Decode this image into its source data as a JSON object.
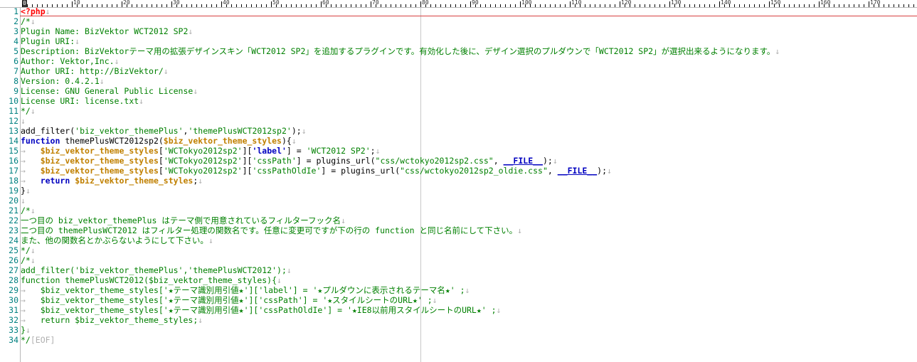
{
  "ruler": {
    "cursor_col": "0",
    "labels": [
      "10",
      "20",
      "30",
      "40",
      "50",
      "60",
      "70",
      "80",
      "90",
      "100",
      "110",
      "120",
      "130",
      "140",
      "150",
      "160",
      "170"
    ]
  },
  "eol_mark": "↓",
  "tab_mark": "→",
  "lines": [
    {
      "n": "1",
      "segments": [
        {
          "t": "php",
          "v": "<?php"
        },
        {
          "t": "mark",
          "v": "↓"
        }
      ]
    },
    {
      "n": "2",
      "segments": [
        {
          "t": "cm",
          "v": "/*"
        },
        {
          "t": "mark",
          "v": "↓"
        }
      ]
    },
    {
      "n": "3",
      "segments": [
        {
          "t": "cm",
          "v": "Plugin Name: BizVektor WCT2012 SP2"
        },
        {
          "t": "mark",
          "v": "↓"
        }
      ]
    },
    {
      "n": "4",
      "segments": [
        {
          "t": "cm",
          "v": "Plugin URI:"
        },
        {
          "t": "mark",
          "v": "↓"
        }
      ]
    },
    {
      "n": "5",
      "segments": [
        {
          "t": "cm",
          "v": "Description: BizVektorテーマ用の拡張デザインスキン「WCT2012 SP2」を追加するプラグインです。有効化した後に、デザイン選択のプルダウンで「WCT2012 SP2」が選択出来るようになります。"
        },
        {
          "t": "mark",
          "v": "↓"
        }
      ]
    },
    {
      "n": "6",
      "segments": [
        {
          "t": "cm",
          "v": "Author: Vektor,Inc."
        },
        {
          "t": "mark",
          "v": "↓"
        }
      ]
    },
    {
      "n": "7",
      "segments": [
        {
          "t": "cm",
          "v": "Author URI: http://BizVektor/"
        },
        {
          "t": "mark",
          "v": "↓"
        }
      ]
    },
    {
      "n": "8",
      "segments": [
        {
          "t": "cm",
          "v": "Version: 0.4.2.1"
        },
        {
          "t": "mark",
          "v": "↓"
        }
      ]
    },
    {
      "n": "9",
      "segments": [
        {
          "t": "cm",
          "v": "License: GNU General Public License"
        },
        {
          "t": "mark",
          "v": "↓"
        }
      ]
    },
    {
      "n": "10",
      "segments": [
        {
          "t": "cm",
          "v": "License URI: license.txt"
        },
        {
          "t": "mark",
          "v": "↓"
        }
      ]
    },
    {
      "n": "11",
      "segments": [
        {
          "t": "cm",
          "v": "*/"
        },
        {
          "t": "mark",
          "v": "↓"
        }
      ]
    },
    {
      "n": "12",
      "segments": [
        {
          "t": "mark",
          "v": "↓"
        }
      ]
    },
    {
      "n": "13",
      "segments": [
        {
          "t": "fn",
          "v": "add_filter("
        },
        {
          "t": "str",
          "v": "'biz_vektor_themePlus'"
        },
        {
          "t": "fn",
          "v": ","
        },
        {
          "t": "str",
          "v": "'themePlusWCT2012sp2'"
        },
        {
          "t": "fn",
          "v": ");"
        },
        {
          "t": "mark",
          "v": "↓"
        }
      ]
    },
    {
      "n": "14",
      "segments": [
        {
          "t": "kw",
          "v": "function"
        },
        {
          "t": "fn",
          "v": " themePlusWCT2012sp2("
        },
        {
          "t": "var",
          "v": "$biz_vektor_theme_styles"
        },
        {
          "t": "fn",
          "v": "){"
        },
        {
          "t": "mark",
          "v": "↓"
        }
      ]
    },
    {
      "n": "15",
      "segments": [
        {
          "t": "mark",
          "v": "→   "
        },
        {
          "t": "var",
          "v": "$biz_vektor_theme_styles"
        },
        {
          "t": "fn",
          "v": "["
        },
        {
          "t": "str",
          "v": "'WCTokyo2012sp2'"
        },
        {
          "t": "fn",
          "v": "]["
        },
        {
          "t": "kw",
          "v": "'label'"
        },
        {
          "t": "fn",
          "v": "] = "
        },
        {
          "t": "str",
          "v": "'WCT2012 SP2'"
        },
        {
          "t": "fn",
          "v": ";"
        },
        {
          "t": "mark",
          "v": "↓"
        }
      ]
    },
    {
      "n": "16",
      "segments": [
        {
          "t": "mark",
          "v": "→   "
        },
        {
          "t": "var",
          "v": "$biz_vektor_theme_styles"
        },
        {
          "t": "fn",
          "v": "["
        },
        {
          "t": "str",
          "v": "'WCTokyo2012sp2'"
        },
        {
          "t": "fn",
          "v": "]["
        },
        {
          "t": "str",
          "v": "'cssPath'"
        },
        {
          "t": "fn",
          "v": "] = plugins_url("
        },
        {
          "t": "str",
          "v": "\"css/wctokyo2012sp2.css\""
        },
        {
          "t": "fn",
          "v": ", "
        },
        {
          "t": "const",
          "v": "__FILE__"
        },
        {
          "t": "fn",
          "v": ");"
        },
        {
          "t": "mark",
          "v": "↓"
        }
      ]
    },
    {
      "n": "17",
      "segments": [
        {
          "t": "mark",
          "v": "→   "
        },
        {
          "t": "var",
          "v": "$biz_vektor_theme_styles"
        },
        {
          "t": "fn",
          "v": "["
        },
        {
          "t": "str",
          "v": "'WCTokyo2012sp2'"
        },
        {
          "t": "fn",
          "v": "]["
        },
        {
          "t": "str",
          "v": "'cssPathOldIe'"
        },
        {
          "t": "fn",
          "v": "] = plugins_url("
        },
        {
          "t": "str",
          "v": "\"css/wctokyo2012sp2_oldie.css\""
        },
        {
          "t": "fn",
          "v": ", "
        },
        {
          "t": "const",
          "v": "__FILE__"
        },
        {
          "t": "fn",
          "v": ");"
        },
        {
          "t": "mark",
          "v": "↓"
        }
      ]
    },
    {
      "n": "18",
      "segments": [
        {
          "t": "mark",
          "v": "→   "
        },
        {
          "t": "kw",
          "v": "return"
        },
        {
          "t": "fn",
          "v": " "
        },
        {
          "t": "var",
          "v": "$biz_vektor_theme_styles"
        },
        {
          "t": "fn",
          "v": ";"
        },
        {
          "t": "mark",
          "v": "↓"
        }
      ]
    },
    {
      "n": "19",
      "segments": [
        {
          "t": "fn",
          "v": "}"
        },
        {
          "t": "mark",
          "v": "↓"
        }
      ]
    },
    {
      "n": "20",
      "segments": [
        {
          "t": "mark",
          "v": "↓"
        }
      ]
    },
    {
      "n": "21",
      "segments": [
        {
          "t": "cm",
          "v": "/*"
        },
        {
          "t": "mark",
          "v": "↓"
        }
      ]
    },
    {
      "n": "22",
      "segments": [
        {
          "t": "cm",
          "v": "一つ目の biz_vektor_themePlus はテーマ側で用意されているフィルターフック名"
        },
        {
          "t": "mark",
          "v": "↓"
        }
      ]
    },
    {
      "n": "23",
      "segments": [
        {
          "t": "cm",
          "v": "二つ目の themePlusWCT2012 はフィルター処理の関数名です。任意に変更可ですが下の行の function と同じ名前にして下さい。"
        },
        {
          "t": "mark",
          "v": "↓"
        }
      ]
    },
    {
      "n": "24",
      "segments": [
        {
          "t": "cm",
          "v": "また、他の関数名とかぶらないようにして下さい。"
        },
        {
          "t": "mark",
          "v": "↓"
        }
      ]
    },
    {
      "n": "25",
      "segments": [
        {
          "t": "cm",
          "v": "*/"
        },
        {
          "t": "mark",
          "v": "↓"
        }
      ]
    },
    {
      "n": "26",
      "segments": [
        {
          "t": "cm",
          "v": "/*"
        },
        {
          "t": "mark",
          "v": "↓"
        }
      ]
    },
    {
      "n": "27",
      "segments": [
        {
          "t": "cm",
          "v": "add_filter('biz_vektor_themePlus','themePlusWCT2012');"
        },
        {
          "t": "mark",
          "v": "↓"
        }
      ]
    },
    {
      "n": "28",
      "segments": [
        {
          "t": "cm",
          "v": "function themePlusWCT2012($biz_vektor_theme_styles){"
        },
        {
          "t": "mark",
          "v": "↓"
        }
      ]
    },
    {
      "n": "29",
      "segments": [
        {
          "t": "mark",
          "v": "→   "
        },
        {
          "t": "cm",
          "v": "$biz_vektor_theme_styles['★テーマ識別用引値★']['label'] = '★プルダウンに表示されるテーマ名★' ;"
        },
        {
          "t": "mark",
          "v": "↓"
        }
      ]
    },
    {
      "n": "30",
      "segments": [
        {
          "t": "mark",
          "v": "→   "
        },
        {
          "t": "cm",
          "v": "$biz_vektor_theme_styles['★テーマ識別用引値★']['cssPath'] = '★スタイルシートのURL★' ;"
        },
        {
          "t": "mark",
          "v": "↓"
        }
      ]
    },
    {
      "n": "31",
      "segments": [
        {
          "t": "mark",
          "v": "→   "
        },
        {
          "t": "cm",
          "v": "$biz_vektor_theme_styles['★テーマ識別用引値★']['cssPathOldIe'] = '★IE8以前用スタイルシートのURL★' ;"
        },
        {
          "t": "mark",
          "v": "↓"
        }
      ]
    },
    {
      "n": "32",
      "segments": [
        {
          "t": "mark",
          "v": "→   "
        },
        {
          "t": "cm",
          "v": "return $biz_vektor_theme_styles;"
        },
        {
          "t": "mark",
          "v": "↓"
        }
      ]
    },
    {
      "n": "33",
      "segments": [
        {
          "t": "cm",
          "v": "}"
        },
        {
          "t": "mark",
          "v": "↓"
        }
      ]
    },
    {
      "n": "34",
      "segments": [
        {
          "t": "cm",
          "v": "*/"
        },
        {
          "t": "mark",
          "v": "[EOF]"
        }
      ]
    }
  ]
}
